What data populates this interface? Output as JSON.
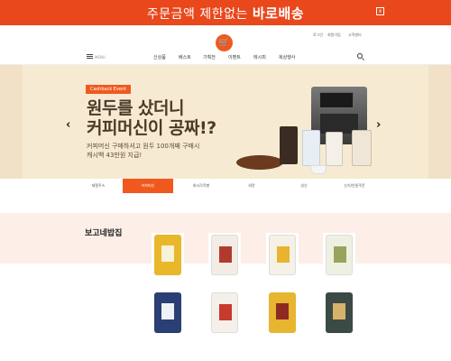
{
  "promo": {
    "text_prefix": "주문금액 제한없는",
    "text_bold": "바로배송",
    "close_icon": "x"
  },
  "utility": {
    "login": "로그인",
    "signup": "회원가입",
    "support": "고객센터"
  },
  "logo": {
    "glyph": "🛒",
    "color": "#f0591e"
  },
  "nav": {
    "menu_label": "MENU",
    "items": [
      "신상품",
      "베스트",
      "기획전",
      "이벤트",
      "레시피",
      "복상행사"
    ]
  },
  "hero": {
    "badge": "Cashback Event",
    "headline_line1": "원두를 샀더니",
    "headline_line2": "커피머신이 공짜!?",
    "sub_line1": "커피머신 구매하셔고 원두 100개째 구매시",
    "sub_line2": "캐시백 43만원 지급!",
    "prev_arrow": "‹",
    "next_arrow": "›",
    "background": "#f6ead3"
  },
  "tabs": [
    "제철주스",
    "커피머신",
    "와사각옥빵",
    "와란",
    "성신",
    "신기/안중주문"
  ],
  "active_tab": 1,
  "section": {
    "title": "보고네밥집"
  },
  "colors": {
    "accent": "#f0591e",
    "promo": "#e8481c",
    "band": "#fdeee8"
  }
}
